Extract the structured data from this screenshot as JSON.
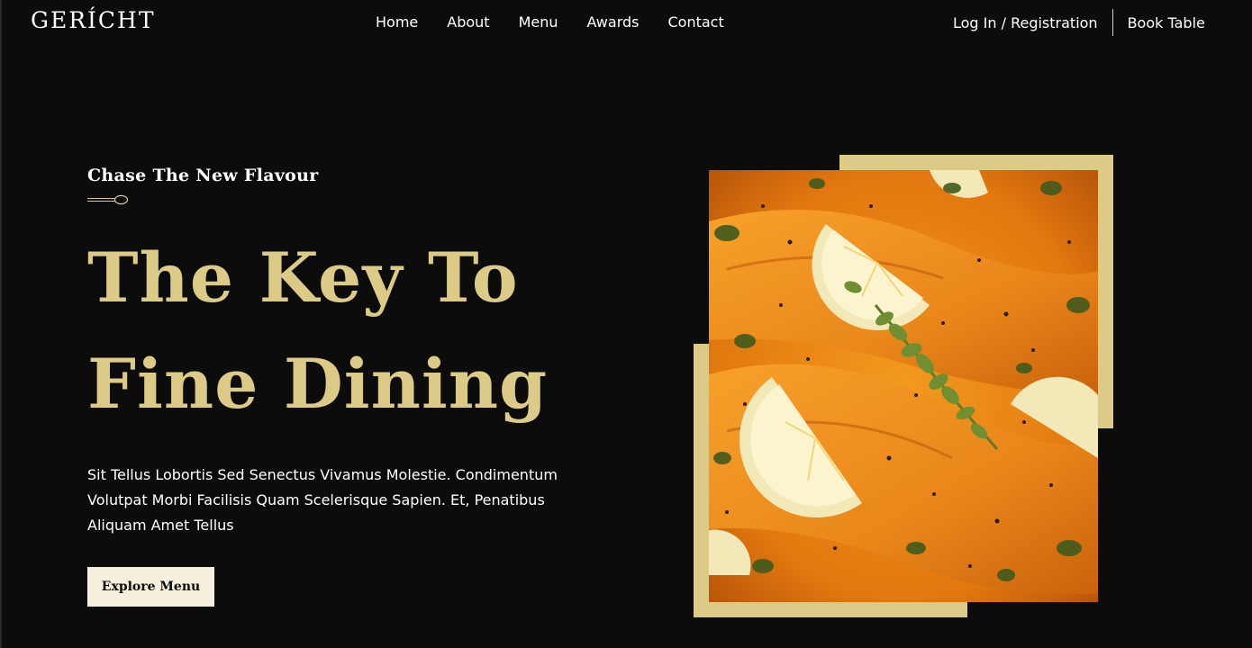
{
  "navbar": {
    "logo": "GERÍCHT",
    "links": [
      "Home",
      "About",
      "Menu",
      "Awards",
      "Contact"
    ],
    "login_label": "Log In / Registration",
    "book_label": "Book Table"
  },
  "hero": {
    "subtitle": "Chase The New Flavour",
    "headline_line1": "The Key To",
    "headline_line2": "Fine Dining",
    "description": "Sit Tellus Lobortis Sed Senectus Vivamus Molestie. Condimentum Volutpat Morbi Facilisis Quam Scelerisque Sapien. Et, Penatibus Aliquam Amet Tellus",
    "cta_label": "Explore Menu"
  },
  "colors": {
    "background": "#0c0c0c",
    "gold": "#dcca87",
    "button_bg": "#f5efdb",
    "text": "#ffffff"
  },
  "icons": {
    "divider": "spoon-icon"
  }
}
